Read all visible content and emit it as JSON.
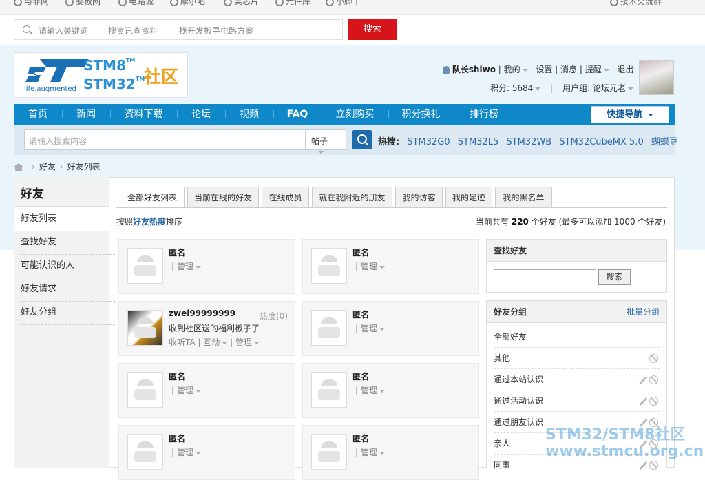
{
  "topbar": {
    "links": [
      "与非网",
      "要板网",
      "电路城",
      "摩尔吧",
      "美芯片",
      "元件库",
      "小脚丫"
    ],
    "right": "技术交流群"
  },
  "search": {
    "placeholder": "请输入关键词",
    "hint1": "搜资讯查资料",
    "hint2": "找开发板寻电路方案",
    "button": "搜索"
  },
  "logo": {
    "tagline": "life.augmented",
    "stm8": "STM8",
    "stm32": "STM32",
    "tm": "TM",
    "community": "社区"
  },
  "user": {
    "name": "队长shiwo",
    "mine": "我的",
    "settings": "设置",
    "messages": "消息",
    "remind": "提醒",
    "logout": "退出",
    "points": "积分: 5684",
    "group": "用户组: 论坛元老"
  },
  "nav": {
    "items": [
      "首页",
      "新闻",
      "资料下载",
      "论坛",
      "视频",
      "FAQ",
      "立刻购买",
      "积分换礼",
      "排行榜"
    ],
    "quick": "快捷导航"
  },
  "subsearch": {
    "placeholder": "请输入搜索内容",
    "scope": "帖子",
    "hot_label": "热搜:",
    "hot": [
      "STM32G0",
      "STM32L5",
      "STM32WB",
      "STM32CubeMX 5.0",
      "蝴蝶豆"
    ]
  },
  "breadcrumb": {
    "items": [
      "好友",
      "好友列表"
    ]
  },
  "sidebar": {
    "title": "好友",
    "items": [
      "好友列表",
      "查找好友",
      "可能认识的人",
      "好友请求",
      "好友分组"
    ]
  },
  "tabs": [
    "全部好友列表",
    "当前在线的好友",
    "在线成员",
    "就在我附近的朋友",
    "我的访客",
    "我的足迹",
    "我的黑名单"
  ],
  "sort": {
    "prefix": "按照",
    "key": "好友热度",
    "suffix": "排序",
    "total_prefix": "当前共有",
    "total": "220",
    "total_suffix": "个好友 (最多可以添加 1000 个好友)"
  },
  "friends": [
    {
      "name": "匿名",
      "manage": "管理"
    },
    {
      "name": "匿名",
      "manage": "管理"
    },
    {
      "name": "zwei99999999",
      "heat": "热度(0)",
      "msg": "收到社区送的福利板子了",
      "listen": "收听TA",
      "interact": "互动",
      "manage": "管理"
    },
    {
      "name": "匿名",
      "manage": "管理"
    },
    {
      "name": "匿名",
      "manage": "管理"
    },
    {
      "name": "匿名",
      "manage": "管理"
    },
    {
      "name": "匿名",
      "manage": "管理"
    },
    {
      "name": "匿名",
      "manage": "管理"
    }
  ],
  "find": {
    "title": "查找好友",
    "button": "搜索"
  },
  "groups": {
    "title": "好友分组",
    "batch": "批量分组",
    "items": [
      "全部好友",
      "其他",
      "通过本站认识",
      "通过活动认识",
      "通过朋友认识",
      "亲人",
      "同事"
    ]
  },
  "watermark": {
    "line1": "STM32/STM8社区",
    "line2": "www.stmcu.org.cn"
  }
}
